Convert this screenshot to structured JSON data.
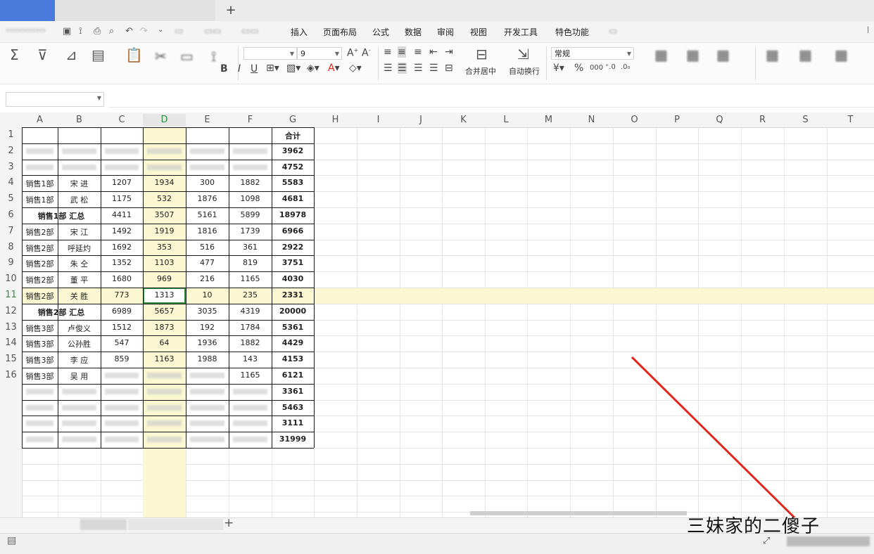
{
  "window": {
    "new_tab": "+"
  },
  "menu": {
    "items": [
      "插入",
      "页面布局",
      "公式",
      "数据",
      "审阅",
      "视图",
      "开发工具",
      "特色功能"
    ]
  },
  "ribbon": {
    "font_size": "9",
    "number_format": "常规",
    "merge_center": "合并居中",
    "wrap_text": "自动换行",
    "bold": "B",
    "italic": "I",
    "underline": "U",
    "currency": "¥",
    "percent": "%",
    "thousands": "000"
  },
  "grid": {
    "columns": [
      "A",
      "B",
      "C",
      "D",
      "E",
      "F",
      "G",
      "H",
      "I",
      "J",
      "K",
      "L",
      "M",
      "N",
      "O",
      "P",
      "Q",
      "R",
      "S",
      "T"
    ],
    "rows": [
      "1",
      "2",
      "3",
      "4",
      "5",
      "6",
      "7",
      "8",
      "9",
      "10",
      "11",
      "12",
      "13",
      "14",
      "15",
      "16"
    ],
    "header_total": "合计",
    "data": [
      {
        "a": "",
        "b": "",
        "c": "",
        "d": "",
        "e": "",
        "f": "",
        "g": "3962"
      },
      {
        "a": "",
        "b": "",
        "c": "",
        "d": "",
        "e": "",
        "f": "",
        "g": "4752"
      },
      {
        "a": "销售1部",
        "b": "宋  进",
        "c": "1207",
        "d": "1934",
        "e": "300",
        "f": "1882",
        "g": "5583"
      },
      {
        "a": "销售1部",
        "b": "武  松",
        "c": "1175",
        "d": "532",
        "e": "1876",
        "f": "1098",
        "g": "4681"
      },
      {
        "a": "销售1部 汇总",
        "b": "",
        "c": "4411",
        "d": "3507",
        "e": "5161",
        "f": "5899",
        "g": "18978",
        "subtotal": true
      },
      {
        "a": "销售2部",
        "b": "宋  江",
        "c": "1492",
        "d": "1919",
        "e": "1816",
        "f": "1739",
        "g": "6966"
      },
      {
        "a": "销售2部",
        "b": "呼延灼",
        "c": "1692",
        "d": "353",
        "e": "516",
        "f": "361",
        "g": "2922"
      },
      {
        "a": "销售2部",
        "b": "朱  仝",
        "c": "1352",
        "d": "1103",
        "e": "477",
        "f": "819",
        "g": "3751"
      },
      {
        "a": "销售2部",
        "b": "董  平",
        "c": "1680",
        "d": "969",
        "e": "216",
        "f": "1165",
        "g": "4030"
      },
      {
        "a": "销售2部",
        "b": "关  胜",
        "c": "773",
        "d": "1313",
        "e": "10",
        "f": "235",
        "g": "2331"
      },
      {
        "a": "销售2部 汇总",
        "b": "",
        "c": "6989",
        "d": "5657",
        "e": "3035",
        "f": "4319",
        "g": "20000",
        "subtotal": true
      },
      {
        "a": "销售3部",
        "b": "卢俊义",
        "c": "1512",
        "d": "1873",
        "e": "192",
        "f": "1784",
        "g": "5361"
      },
      {
        "a": "销售3部",
        "b": "公孙胜",
        "c": "547",
        "d": "64",
        "e": "1936",
        "f": "1882",
        "g": "4429"
      },
      {
        "a": "销售3部",
        "b": "李  应",
        "c": "859",
        "d": "1163",
        "e": "1988",
        "f": "143",
        "g": "4153"
      },
      {
        "a": "销售3部",
        "b": "吴  用",
        "c": "",
        "d": "",
        "e": "",
        "f": "1165",
        "g": "6121"
      },
      {
        "a": "",
        "b": "",
        "c": "",
        "d": "",
        "e": "",
        "f": "",
        "g": "3361"
      },
      {
        "a": "",
        "b": "",
        "c": "",
        "d": "",
        "e": "",
        "f": "",
        "g": "5463"
      },
      {
        "a": "",
        "b": "",
        "c": "",
        "d": "",
        "e": "",
        "f": "",
        "g": "3111"
      },
      {
        "a": "",
        "b": "",
        "c": "",
        "d": "",
        "e": "",
        "f": "",
        "g": "31999"
      }
    ]
  },
  "sheetbar": {
    "add_sheet": "+"
  },
  "watermark": "三妹家的二傻子",
  "colors": {
    "accent_blue": "#4a7bdc",
    "selection_yellow": "#fbf7d2",
    "active_cell": "#2f8f3f",
    "arrow_red": "#e0261b"
  }
}
